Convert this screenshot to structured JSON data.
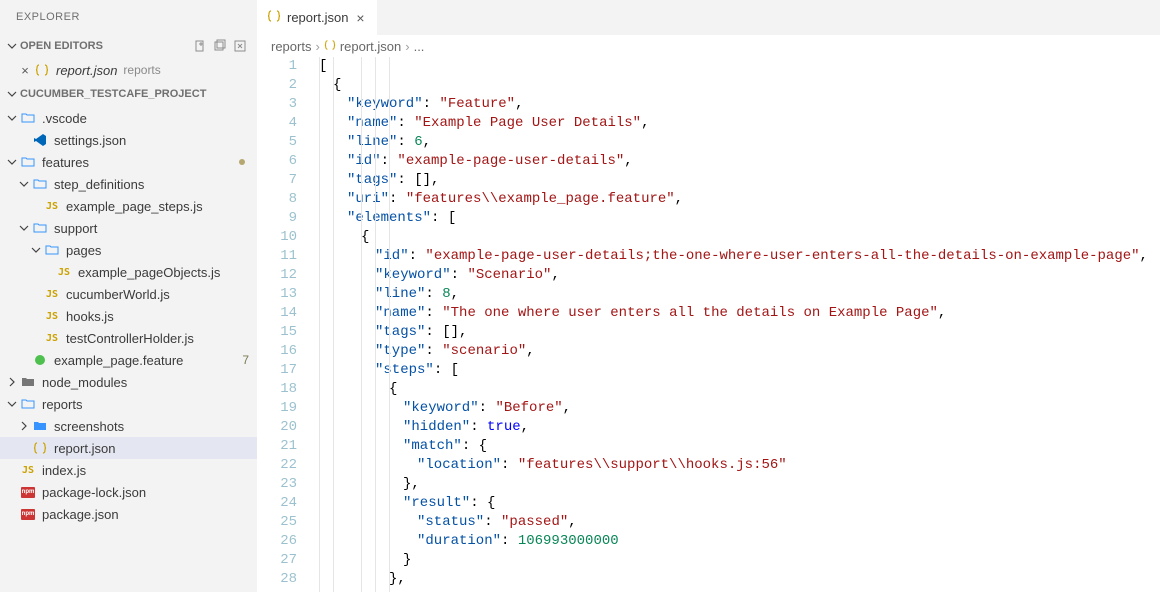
{
  "explorer": {
    "title": "EXPLORER"
  },
  "openEditors": {
    "title": "OPEN EDITORS",
    "items": [
      {
        "label": "report.json",
        "sub": "reports",
        "icon": "json"
      }
    ]
  },
  "project": {
    "title": "CUCUMBER_TESTCAFE_PROJECT",
    "tree": [
      {
        "label": ".vscode",
        "icon": "vscode-folder",
        "depth": 1,
        "expanded": true
      },
      {
        "label": "settings.json",
        "icon": "vscode",
        "depth": 2
      },
      {
        "label": "features",
        "icon": "folder",
        "depth": 1,
        "expanded": true,
        "modified": true
      },
      {
        "label": "step_definitions",
        "icon": "folder",
        "depth": 2,
        "expanded": true
      },
      {
        "label": "example_page_steps.js",
        "icon": "js",
        "depth": 3
      },
      {
        "label": "support",
        "icon": "folder",
        "depth": 2,
        "expanded": true
      },
      {
        "label": "pages",
        "icon": "folder",
        "depth": 3,
        "expanded": true
      },
      {
        "label": "example_pageObjects.js",
        "icon": "js",
        "depth": 4
      },
      {
        "label": "cucumberWorld.js",
        "icon": "js",
        "depth": 3
      },
      {
        "label": "hooks.js",
        "icon": "js",
        "depth": 3
      },
      {
        "label": "testControllerHolder.js",
        "icon": "js",
        "depth": 3
      },
      {
        "label": "example_page.feature",
        "icon": "feature",
        "depth": 2,
        "badge": "7"
      },
      {
        "label": "node_modules",
        "icon": "folder-dark",
        "depth": 1,
        "expanded": false
      },
      {
        "label": "reports",
        "icon": "folder",
        "depth": 1,
        "expanded": true
      },
      {
        "label": "screenshots",
        "icon": "folder-closed",
        "depth": 2,
        "expanded": false
      },
      {
        "label": "report.json",
        "icon": "json",
        "depth": 2,
        "active": true
      },
      {
        "label": "index.js",
        "icon": "js",
        "depth": 1
      },
      {
        "label": "package-lock.json",
        "icon": "npm",
        "depth": 1
      },
      {
        "label": "package.json",
        "icon": "npm",
        "depth": 1
      }
    ]
  },
  "tab": {
    "label": "report.json"
  },
  "breadcrumb": {
    "seg1": "reports",
    "seg2": "report.json",
    "seg3": "..."
  },
  "code": {
    "lines": [
      {
        "n": 1,
        "html": "<span class='p'>[</span>"
      },
      {
        "n": 2,
        "html": "<span class='ind2'><span class='p'>{</span></span>"
      },
      {
        "n": 3,
        "html": "<span class='ind3'><span class='k'>\"keyword\"</span><span class='p'>: </span><span class='s'>\"Feature\"</span><span class='p'>,</span></span>"
      },
      {
        "n": 4,
        "html": "<span class='ind3'><span class='k'>\"name\"</span><span class='p'>: </span><span class='s'>\"Example Page User Details\"</span><span class='p'>,</span></span>"
      },
      {
        "n": 5,
        "html": "<span class='ind3'><span class='k'>\"line\"</span><span class='p'>: </span><span class='n'>6</span><span class='p'>,</span></span>"
      },
      {
        "n": 6,
        "html": "<span class='ind3'><span class='k'>\"id\"</span><span class='p'>: </span><span class='s'>\"example-page-user-details\"</span><span class='p'>,</span></span>"
      },
      {
        "n": 7,
        "html": "<span class='ind3'><span class='k'>\"tags\"</span><span class='p'>: [],</span></span>"
      },
      {
        "n": 8,
        "html": "<span class='ind3'><span class='k'>\"uri\"</span><span class='p'>: </span><span class='s'>\"features\\\\example_page.feature\"</span><span class='p'>,</span></span>"
      },
      {
        "n": 9,
        "html": "<span class='ind3'><span class='k'>\"elements\"</span><span class='p'>: [</span></span>"
      },
      {
        "n": 10,
        "html": "<span class='ind4'><span class='p'>{</span></span>"
      },
      {
        "n": 11,
        "html": "<span class='ind5'><span class='k'>\"id\"</span><span class='p'>: </span><span class='s'>\"example-page-user-details;the-one-where-user-enters-all-the-details-on-example-page\"</span><span class='p'>,</span></span>"
      },
      {
        "n": 12,
        "html": "<span class='ind5'><span class='k'>\"keyword\"</span><span class='p'>: </span><span class='s'>\"Scenario\"</span><span class='p'>,</span></span>"
      },
      {
        "n": 13,
        "html": "<span class='ind5'><span class='k'>\"line\"</span><span class='p'>: </span><span class='n'>8</span><span class='p'>,</span></span>"
      },
      {
        "n": 14,
        "html": "<span class='ind5'><span class='k'>\"name\"</span><span class='p'>: </span><span class='s'>\"The one where user enters all the details on Example Page\"</span><span class='p'>,</span></span>"
      },
      {
        "n": 15,
        "html": "<span class='ind5'><span class='k'>\"tags\"</span><span class='p'>: [],</span></span>"
      },
      {
        "n": 16,
        "html": "<span class='ind5'><span class='k'>\"type\"</span><span class='p'>: </span><span class='s'>\"scenario\"</span><span class='p'>,</span></span>"
      },
      {
        "n": 17,
        "html": "<span class='ind5'><span class='k'>\"steps\"</span><span class='p'>: [</span></span>"
      },
      {
        "n": 18,
        "html": "<span class='ind6'><span class='p'>{</span></span>"
      },
      {
        "n": 19,
        "html": "<span class='ind7'><span class='k'>\"keyword\"</span><span class='p'>: </span><span class='s'>\"Before\"</span><span class='p'>,</span></span>"
      },
      {
        "n": 20,
        "html": "<span class='ind7'><span class='k'>\"hidden\"</span><span class='p'>: </span><span class='b'>true</span><span class='p'>,</span></span>"
      },
      {
        "n": 21,
        "html": "<span class='ind7'><span class='k'>\"match\"</span><span class='p'>: {</span></span>"
      },
      {
        "n": 22,
        "html": "<span class='ind8'><span class='k'>\"location\"</span><span class='p'>: </span><span class='s'>\"features\\\\support\\\\hooks.js:56\"</span></span>"
      },
      {
        "n": 23,
        "html": "<span class='ind7'><span class='p'>},</span></span>"
      },
      {
        "n": 24,
        "html": "<span class='ind7'><span class='k'>\"result\"</span><span class='p'>: {</span></span>"
      },
      {
        "n": 25,
        "html": "<span class='ind8'><span class='k'>\"status\"</span><span class='p'>: </span><span class='s'>\"passed\"</span><span class='p'>,</span></span>"
      },
      {
        "n": 26,
        "html": "<span class='ind8'><span class='k'>\"duration\"</span><span class='p'>: </span><span class='n'>106993000000</span></span>"
      },
      {
        "n": 27,
        "html": "<span class='ind7'><span class='p'>}</span></span>"
      },
      {
        "n": 28,
        "html": "<span class='ind6'><span class='p'>},</span></span>"
      }
    ]
  }
}
